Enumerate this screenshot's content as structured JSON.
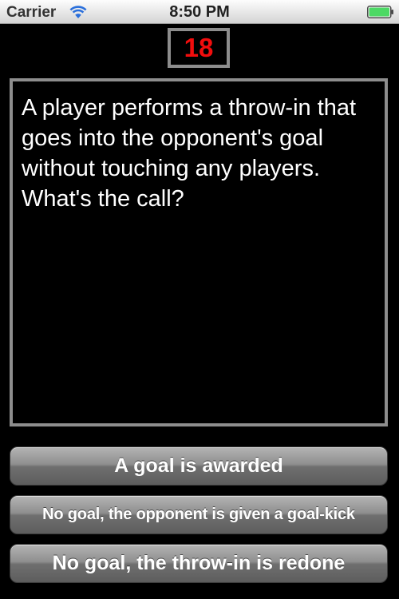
{
  "status_bar": {
    "carrier": "Carrier",
    "time": "8:50 PM",
    "icons": [
      "wifi-icon",
      "battery-icon"
    ],
    "battery_level": 1.0
  },
  "timer": {
    "value": "18",
    "color": "#f20d0d"
  },
  "question": {
    "text": "A player performs a throw-in that goes into the opponent's goal without touching any players. What's the call?"
  },
  "answers": [
    {
      "label": "A goal is awarded"
    },
    {
      "label": "No goal, the opponent is given a goal-kick"
    },
    {
      "label": "No goal, the throw-in is redone"
    }
  ],
  "colors": {
    "background": "#000000",
    "border": "#8d8d8d",
    "battery_fill": "#4cd964"
  }
}
